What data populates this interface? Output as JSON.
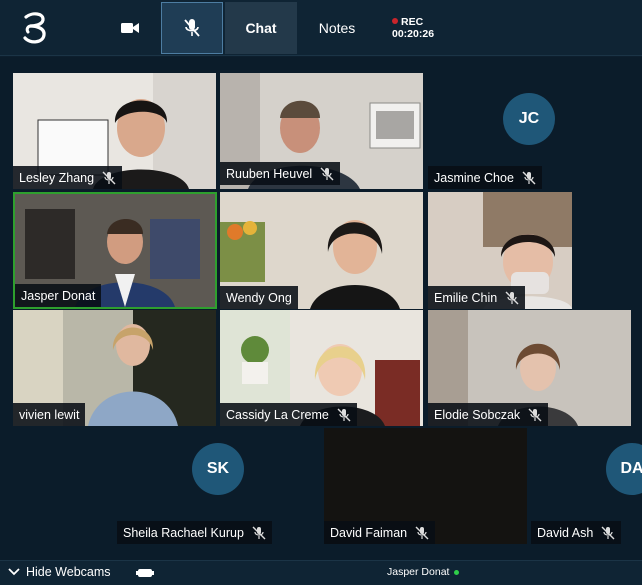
{
  "toolbar": {
    "chat_label": "Chat",
    "notes_label": "Notes",
    "rec_label": "REC",
    "rec_time": "00:20:26"
  },
  "participants": [
    {
      "name": "Lesley Zhang",
      "muted": true,
      "video": true
    },
    {
      "name": "Ruuben Heuvel",
      "muted": true,
      "video": true
    },
    {
      "name": "Jasmine Choe",
      "muted": true,
      "video": false,
      "initials": "JC"
    },
    {
      "name": "Jasper Donat",
      "muted": false,
      "video": true,
      "active_speaker": true
    },
    {
      "name": "Wendy Ong",
      "muted": false,
      "video": true
    },
    {
      "name": "Emilie Chin",
      "muted": true,
      "video": true
    },
    {
      "name": "vivien lewit",
      "muted": false,
      "video": true
    },
    {
      "name": "Cassidy La Creme",
      "muted": true,
      "video": true
    },
    {
      "name": "Elodie Sobczak",
      "muted": true,
      "video": true
    },
    {
      "name": "Sheila Rachael Kurup",
      "muted": true,
      "video": false,
      "initials": "SK"
    },
    {
      "name": "David Faiman",
      "muted": true,
      "video": true
    },
    {
      "name": "David Ash",
      "muted": true,
      "video": false,
      "initials": "DA"
    }
  ],
  "bottom": {
    "hide_webcams_label": "Hide Webcams",
    "presenter_name": "Jasper Donat"
  },
  "colors": {
    "accent_active": "#2ea02e",
    "avatar_bg": "#1f5778",
    "topbar_bg": "#0f2434",
    "rec_dot": "#c9252b",
    "online_dot": "#2fcf4a"
  }
}
